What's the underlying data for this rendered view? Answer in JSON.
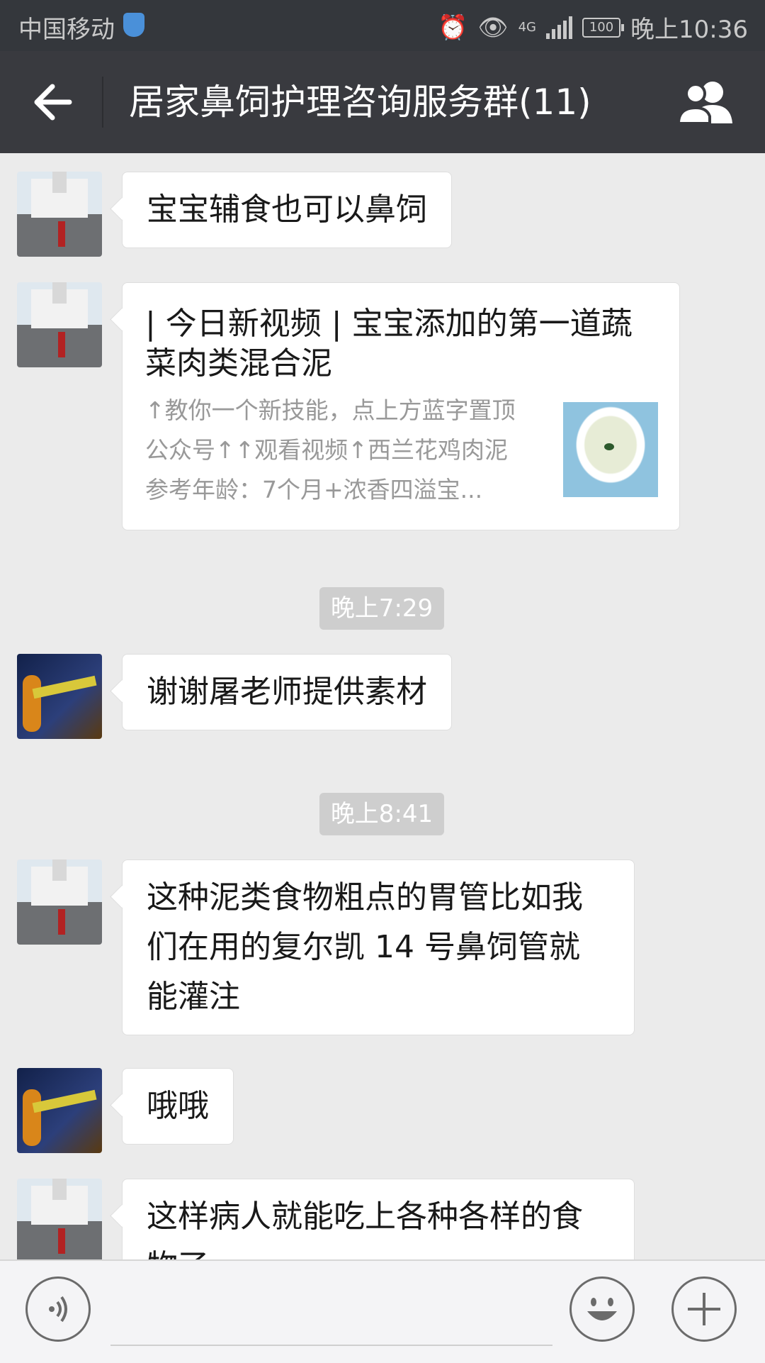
{
  "status_bar": {
    "carrier": "中国移动",
    "network": "4G",
    "battery": "100",
    "time": "晚上10:36"
  },
  "header": {
    "title": "居家鼻饲护理咨询服务群(11)",
    "back_icon": "back-arrow-icon",
    "group_icon": "group-members-icon"
  },
  "messages": [
    {
      "type": "text",
      "avatar": "church-avatar",
      "text": "宝宝辅食也可以鼻饲"
    },
    {
      "type": "link",
      "avatar": "church-avatar",
      "title": "| 今日新视频 | 宝宝添加的第一道蔬菜肉类混合泥",
      "description": "↑教你一个新技能，点上方蓝字置顶公众号↑↑观看视频↑西兰花鸡肉泥参考年龄：7个月+浓香四溢宝..."
    },
    {
      "type": "time",
      "text": "晚上7:29"
    },
    {
      "type": "text",
      "avatar": "fire-avatar",
      "text": "谢谢屠老师提供素材"
    },
    {
      "type": "time",
      "text": "晚上8:41"
    },
    {
      "type": "text",
      "avatar": "church-avatar",
      "text": "这种泥类食物粗点的胃管比如我们在用的复尔凯 14 号鼻饲管就能灌注"
    },
    {
      "type": "text",
      "avatar": "fire-avatar",
      "text": "哦哦"
    },
    {
      "type": "text",
      "avatar": "church-avatar",
      "text": "这样病人就能吃上各种各样的食物了"
    }
  ],
  "input_bar": {
    "voice_icon": "voice-icon",
    "emoji_icon": "emoji-icon",
    "plus_icon": "plus-icon"
  },
  "colors": {
    "header_bg": "#393a3f",
    "status_bg": "#34373c",
    "chat_bg": "#ebebeb",
    "time_bg": "#cecece"
  }
}
